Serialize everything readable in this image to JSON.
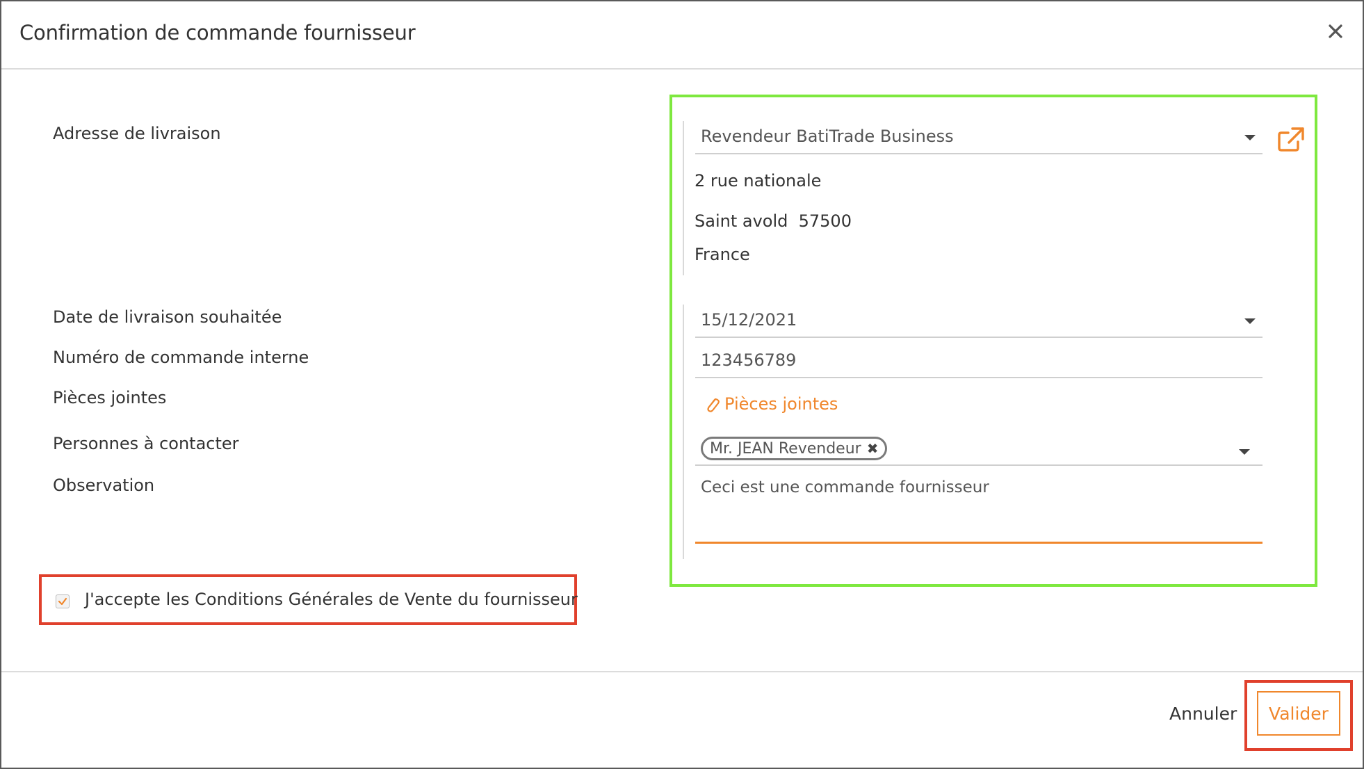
{
  "dialog": {
    "title": "Confirmation de commande fournisseur",
    "close_icon": "close-icon"
  },
  "labels": {
    "delivery_address": "Adresse de livraison",
    "delivery_date": "Date de livraison souhaitée",
    "internal_order_number": "Numéro de commande interne",
    "attachments": "Pièces jointes",
    "contacts": "Personnes à contacter",
    "observation": "Observation"
  },
  "address": {
    "selected": "Revendeur BatiTrade Business",
    "street": "2 rue nationale",
    "city_postal": "Saint avold  57500",
    "country": "France"
  },
  "fields": {
    "delivery_date": "15/12/2021",
    "internal_order_number": "123456789",
    "attachments_link": "Pièces jointes",
    "contact_chip": "Mr. JEAN Revendeur",
    "observation": "Ceci est une commande fournisseur"
  },
  "terms": {
    "label": "J'accepte les Conditions Générales de Vente du fournisseur",
    "checked": true
  },
  "footer": {
    "cancel_label": "Annuler",
    "validate_label": "Valider"
  },
  "colors": {
    "accent": "#f0872c",
    "highlight_green": "#7ee83f",
    "highlight_red": "#e0402c"
  }
}
